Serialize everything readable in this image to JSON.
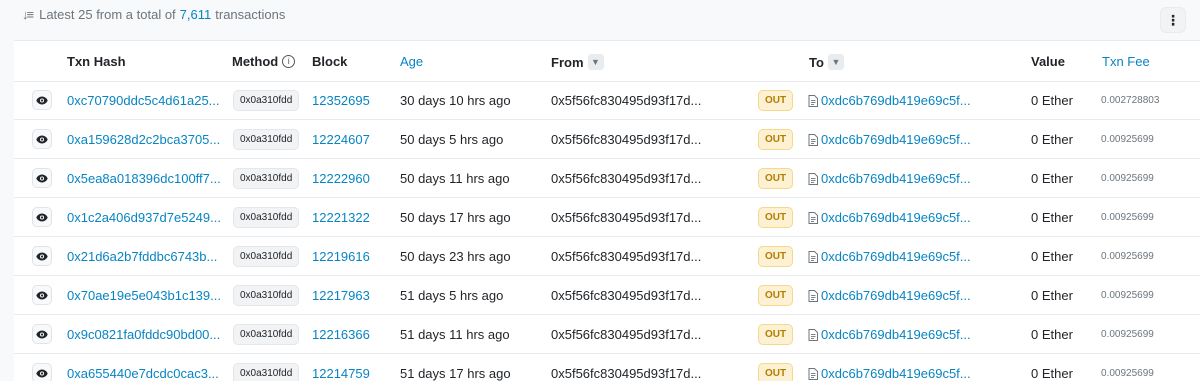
{
  "summary": {
    "prefix": "Latest 25 from a total of",
    "count": "7,611",
    "suffix": "transactions"
  },
  "icons": {
    "sort": "sort-descending-icon",
    "more": "more-vertical-icon",
    "info": "info-circle-icon",
    "filter": "filter-icon",
    "eye": "eye-icon",
    "contract": "document-icon"
  },
  "colors": {
    "link": "#0784c3",
    "out_badge_bg": "#fdf1d3",
    "out_badge_text": "#b47d00"
  },
  "headers": {
    "txn_hash": "Txn Hash",
    "method": "Method",
    "block": "Block",
    "age": "Age",
    "from": "From",
    "to": "To",
    "value": "Value",
    "txn_fee": "Txn Fee"
  },
  "rows": [
    {
      "hash": "0xc70790ddc5c4d61a25...",
      "method": "0x0a310fdd",
      "block": "12352695",
      "age": "30 days 10 hrs ago",
      "from": "0x5f56fc830495d93f17d...",
      "direction": "OUT",
      "to": "0xdc6b769db419e69c5f...",
      "value": "0 Ether",
      "fee": "0.002728803"
    },
    {
      "hash": "0xa159628d2c2bca3705...",
      "method": "0x0a310fdd",
      "block": "12224607",
      "age": "50 days 5 hrs ago",
      "from": "0x5f56fc830495d93f17d...",
      "direction": "OUT",
      "to": "0xdc6b769db419e69c5f...",
      "value": "0 Ether",
      "fee": "0.00925699"
    },
    {
      "hash": "0x5ea8a018396dc100ff7...",
      "method": "0x0a310fdd",
      "block": "12222960",
      "age": "50 days 11 hrs ago",
      "from": "0x5f56fc830495d93f17d...",
      "direction": "OUT",
      "to": "0xdc6b769db419e69c5f...",
      "value": "0 Ether",
      "fee": "0.00925699"
    },
    {
      "hash": "0x1c2a406d937d7e5249...",
      "method": "0x0a310fdd",
      "block": "12221322",
      "age": "50 days 17 hrs ago",
      "from": "0x5f56fc830495d93f17d...",
      "direction": "OUT",
      "to": "0xdc6b769db419e69c5f...",
      "value": "0 Ether",
      "fee": "0.00925699"
    },
    {
      "hash": "0x21d6a2b7fddbc6743b...",
      "method": "0x0a310fdd",
      "block": "12219616",
      "age": "50 days 23 hrs ago",
      "from": "0x5f56fc830495d93f17d...",
      "direction": "OUT",
      "to": "0xdc6b769db419e69c5f...",
      "value": "0 Ether",
      "fee": "0.00925699"
    },
    {
      "hash": "0x70ae19e5e043b1c139...",
      "method": "0x0a310fdd",
      "block": "12217963",
      "age": "51 days 5 hrs ago",
      "from": "0x5f56fc830495d93f17d...",
      "direction": "OUT",
      "to": "0xdc6b769db419e69c5f...",
      "value": "0 Ether",
      "fee": "0.00925699"
    },
    {
      "hash": "0x9c0821fa0fddc90bd00...",
      "method": "0x0a310fdd",
      "block": "12216366",
      "age": "51 days 11 hrs ago",
      "from": "0x5f56fc830495d93f17d...",
      "direction": "OUT",
      "to": "0xdc6b769db419e69c5f...",
      "value": "0 Ether",
      "fee": "0.00925699"
    },
    {
      "hash": "0xa655440e7dcdc0cac3...",
      "method": "0x0a310fdd",
      "block": "12214759",
      "age": "51 days 17 hrs ago",
      "from": "0x5f56fc830495d93f17d...",
      "direction": "OUT",
      "to": "0xdc6b769db419e69c5f...",
      "value": "0 Ether",
      "fee": "0.00925699"
    }
  ]
}
